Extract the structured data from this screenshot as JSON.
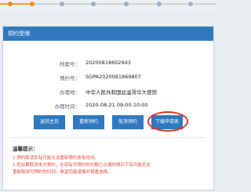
{
  "card": {
    "title": "预约受理"
  },
  "info": [
    {
      "label": "档案号：",
      "value": "20200818602943"
    },
    {
      "label": "预约号：",
      "value": "SGPA2020081869807"
    },
    {
      "label": "办理地：",
      "value": "中华人民共和国驻温哥华大使馆"
    },
    {
      "label": "办理时间：",
      "value": "2020-08-21 09:00-10:00"
    }
  ],
  "buttons": {
    "back": "返回主页",
    "rebook": "重新预约",
    "cancel": "取消预约",
    "download": "下载申请表"
  },
  "notes": {
    "title": "温馨提示：",
    "items": [
      "1.预约取消后有可能无法重新预约原有时间。",
      "2.您如果取消本次预约，在现有可预约的日期已占满的情况下有可能无法",
      "重新取得可预约的时间，希望您能谨慎并慎重选择。"
    ]
  },
  "colors": {
    "accent": "#2f79bf",
    "highlight_circle": "#e0342e",
    "step_active": "#f08c1a"
  }
}
